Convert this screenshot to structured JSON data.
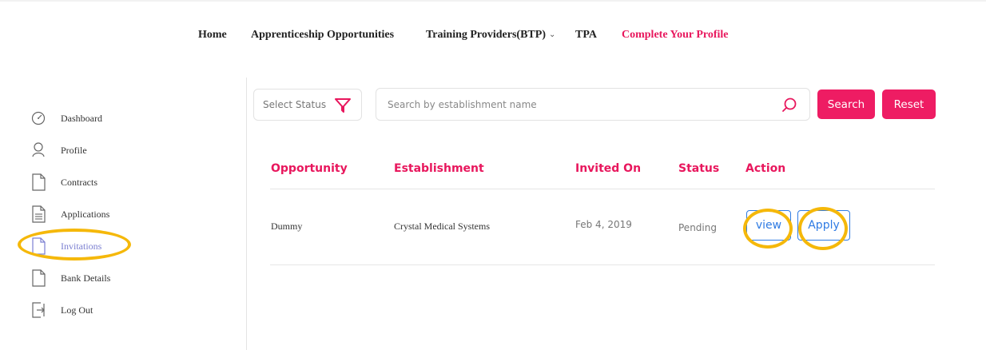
{
  "nav": {
    "items": [
      {
        "label": "Home"
      },
      {
        "label": "Apprenticeship Opportunities"
      },
      {
        "label": "Training Providers(BTP)"
      },
      {
        "label": "TPA"
      },
      {
        "label": "Complete Your Profile"
      }
    ]
  },
  "sidebar": {
    "items": [
      {
        "label": "Dashboard",
        "icon": "dashboard-gauge-icon"
      },
      {
        "label": "Profile",
        "icon": "user-icon"
      },
      {
        "label": "Contracts",
        "icon": "document-icon"
      },
      {
        "label": "Applications",
        "icon": "document-lines-icon"
      },
      {
        "label": "Invitations",
        "icon": "document-icon",
        "active": true
      },
      {
        "label": "Bank Details",
        "icon": "document-icon"
      },
      {
        "label": "Log Out",
        "icon": "logout-icon"
      }
    ]
  },
  "filters": {
    "status_placeholder": "Select Status",
    "search_placeholder": "Search by establishment name",
    "search_label": "Search",
    "reset_label": "Reset"
  },
  "table": {
    "headers": [
      "Opportunity",
      "Establishment",
      "Invited On",
      "Status",
      "Action"
    ],
    "rows": [
      {
        "opportunity": "Dummy",
        "establishment": "Crystal Medical Systems",
        "invited_on": "Feb 4, 2019",
        "status": "Pending",
        "view_label": "view",
        "apply_label": "Apply"
      }
    ]
  },
  "colors": {
    "accent_pink": "#e8175d",
    "button_pink": "#ee1c63",
    "link_blue": "#2f7be3",
    "highlight_yellow": "#f5b80a"
  }
}
